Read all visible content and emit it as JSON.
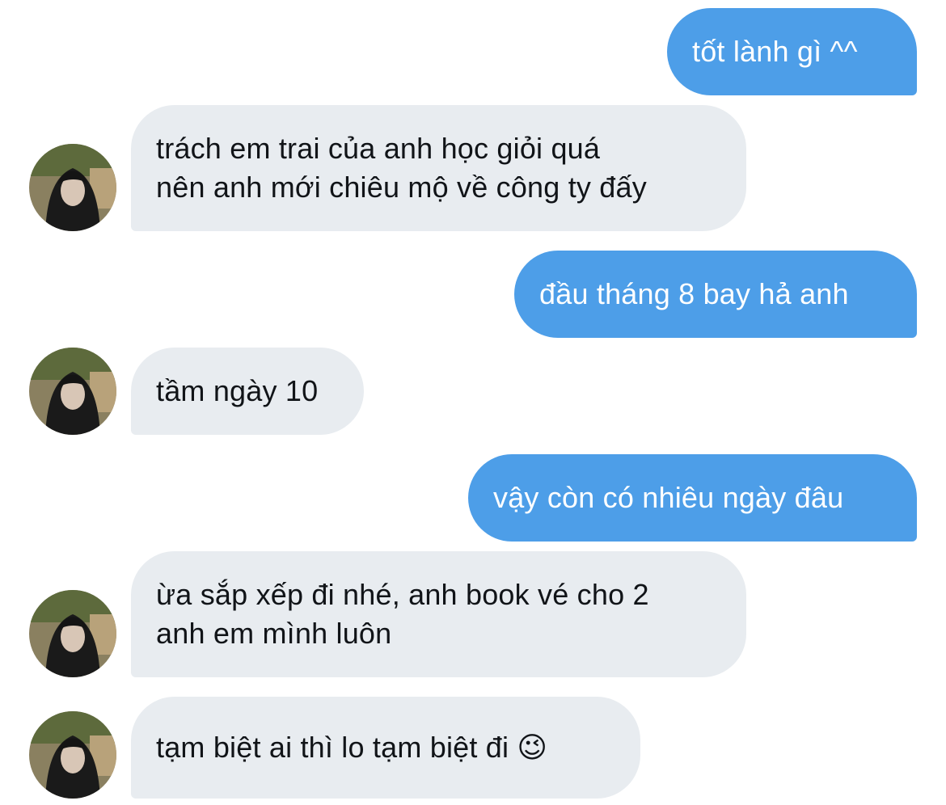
{
  "conversation": {
    "messages": [
      {
        "side": "outgoing",
        "text": "tốt lành gì ^^"
      },
      {
        "side": "incoming",
        "text": "trách em trai của anh học giỏi quá\nnên anh mới chiêu mộ về công ty đấy"
      },
      {
        "side": "outgoing",
        "text": "đầu tháng 8 bay hả anh"
      },
      {
        "side": "incoming",
        "text": "tầm ngày 10"
      },
      {
        "side": "outgoing",
        "text": "vậy còn có nhiêu ngày đâu"
      },
      {
        "side": "incoming",
        "text": "ừa sắp xếp đi nhé, anh book vé cho 2\nanh em mình luôn"
      },
      {
        "side": "incoming",
        "text": "tạm biệt ai thì lo tạm biệt đi 😉"
      }
    ]
  },
  "colors": {
    "outgoing_bubble": "#4d9ee8",
    "incoming_bubble": "#e8ecf0",
    "outgoing_text": "#ffffff",
    "incoming_text": "#111418"
  },
  "icons": {
    "avatar": "contact-avatar-photo"
  }
}
